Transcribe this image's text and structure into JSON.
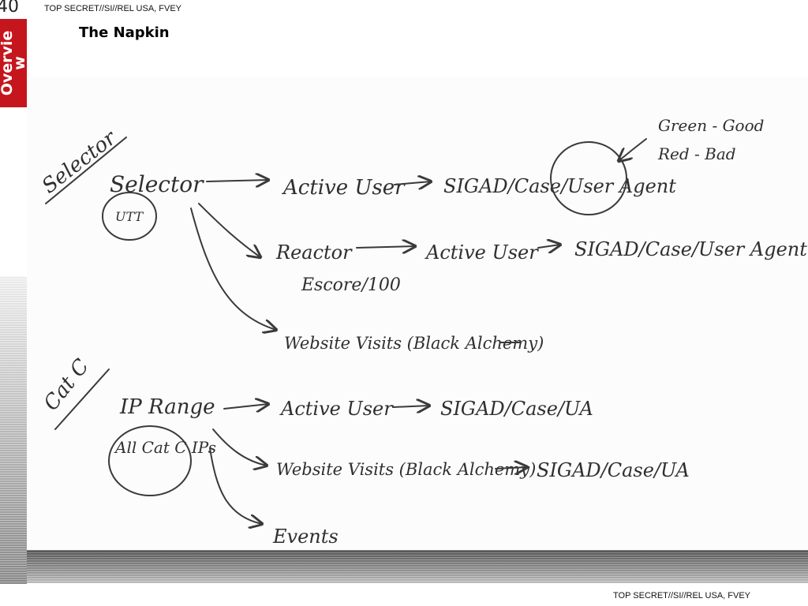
{
  "header": {
    "page_number": "40",
    "classification": "TOP SECRET//SI//REL USA, FVEY",
    "section_tab": "Overview",
    "title": "The Napkin"
  },
  "footer": {
    "classification": "TOP SECRET//SI//REL USA, FVEY"
  },
  "napkin": {
    "legend": {
      "green": "Green - Good",
      "red": "Red - Bad"
    },
    "selector_section": {
      "margin_label": "Selector",
      "source": "Selector",
      "source_note": "UTT",
      "branch_1": [
        "Active User",
        "SIGAD/Case/User Agent"
      ],
      "branch_2": [
        "Reactor",
        "Escore/100",
        "Active User",
        "SIGAD/Case/User Agent"
      ],
      "branch_3": [
        "Website Visits (Black Alchemy)"
      ]
    },
    "catc_section": {
      "margin_label": "Cat C",
      "source": "IP Range",
      "source_note": "All Cat C IPs",
      "branch_1": [
        "Active User",
        "SIGAD/Case/UA"
      ],
      "branch_2": [
        "Website Visits (Black Alchemy)",
        "SIGAD/Case/UA"
      ],
      "branch_3": [
        "Events"
      ]
    }
  }
}
